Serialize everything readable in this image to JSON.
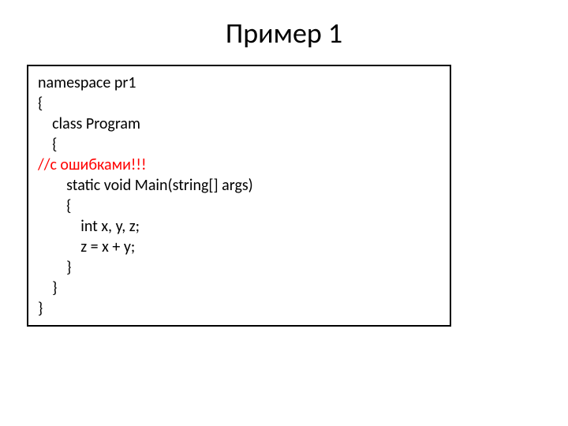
{
  "title": "Пример 1",
  "code": {
    "line1": "namespace pr1",
    "line2": "{",
    "line3": "    class Program",
    "line4": "    {",
    "line5_error": "//с ошибками!!!",
    "line6": "        static void Main(string[] args)",
    "line7": "        {",
    "line8": "            int x, y, z;",
    "line9": "            z = x + y;",
    "line10": "        }",
    "line11": "    }",
    "line12": "}"
  }
}
